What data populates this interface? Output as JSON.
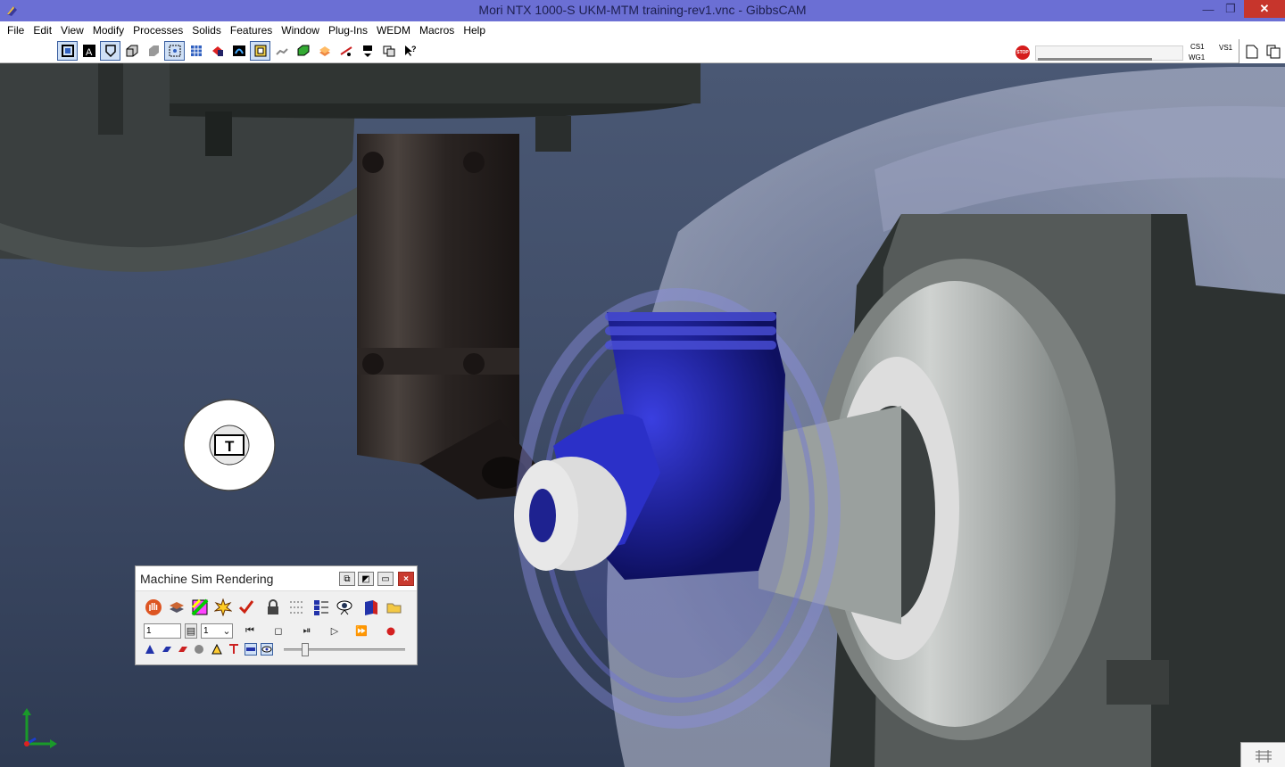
{
  "window": {
    "title": "Mori NTX 1000-S UKM-MTM training-rev1.vnc - GibbsCAM",
    "minimize_label": "—",
    "maximize_label": "❐",
    "close_label": "✕"
  },
  "menu": [
    "File",
    "Edit",
    "View",
    "Modify",
    "Processes",
    "Solids",
    "Features",
    "Window",
    "Plug-Ins",
    "WEDM",
    "Macros",
    "Help"
  ],
  "status": {
    "stop_label": "STOP",
    "cs_label": "CS1",
    "wg_label": "WG1",
    "vs_label": "VS1",
    "progress_fraction": 0.8
  },
  "sim_panel": {
    "title": "Machine Sim Rendering",
    "step_value": "1",
    "speed_value": "1",
    "speed_slider_fraction": 0.16
  },
  "colors": {
    "title_bar": "#6b6fd4",
    "close_red": "#c7352c",
    "part_blue": "#2a2fb0",
    "record_red": "#d42020"
  }
}
